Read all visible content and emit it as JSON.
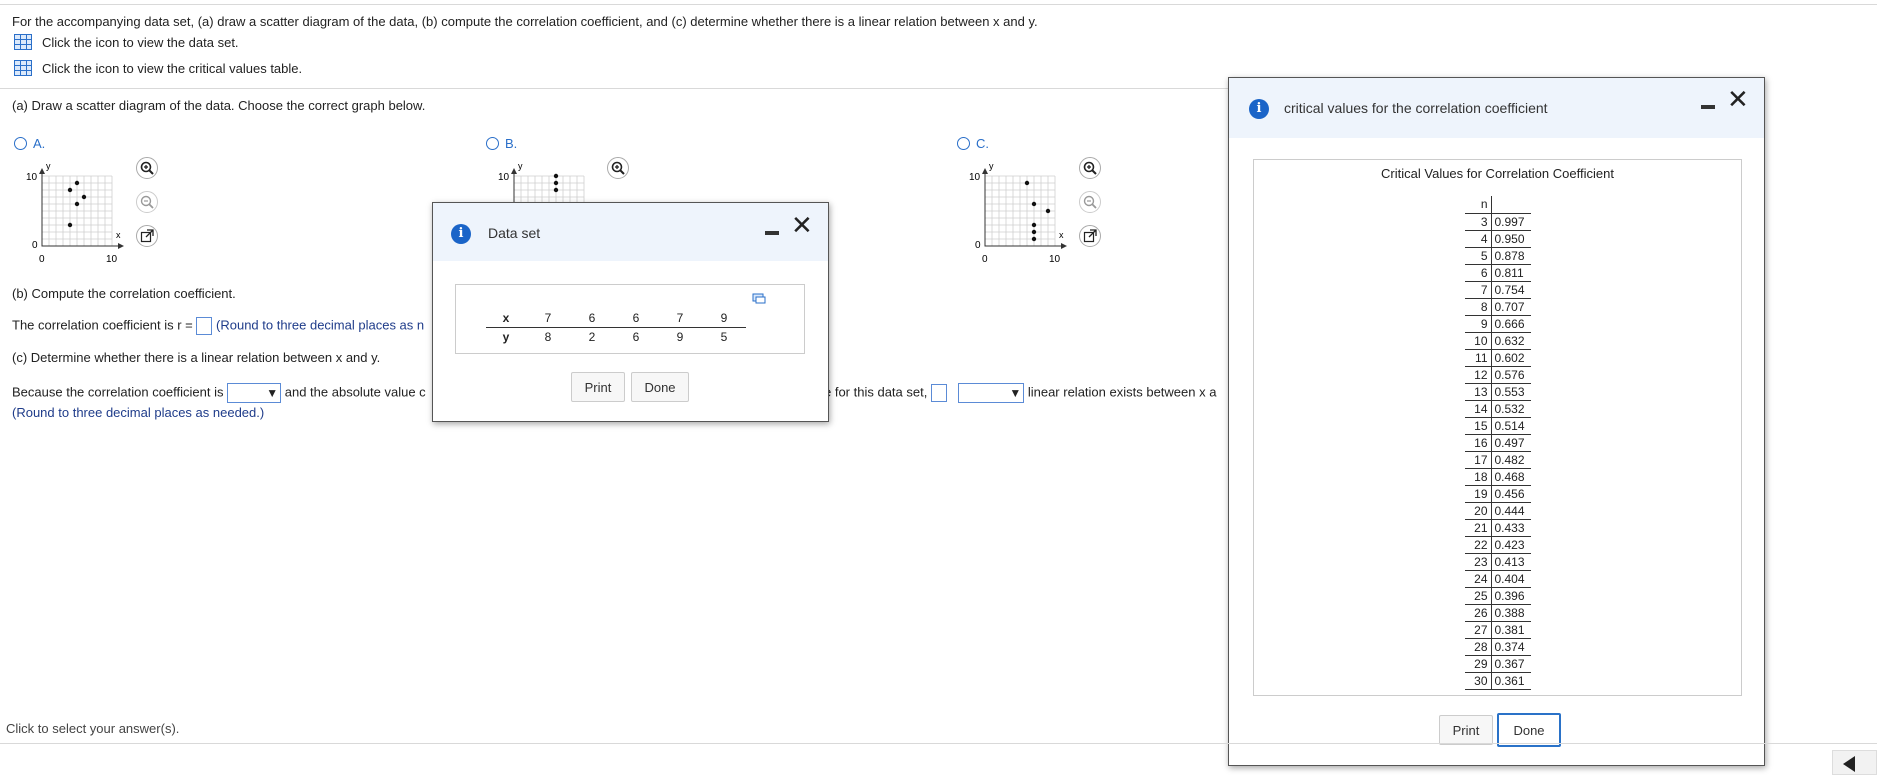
{
  "question": {
    "text": "For the accompanying data set, (a) draw a scatter diagram of the data, (b) compute the correlation coefficient, and (c) determine whether there is a linear relation between x and y.",
    "dataset_link": "Click the icon to view the data set.",
    "critical_link": "Click the icon to view the critical values table."
  },
  "part_a": {
    "prompt": "(a) Draw a scatter diagram of the data. Choose the correct graph below.",
    "options": [
      {
        "label": "A.",
        "axis_y_max": "10",
        "axis_y_min": "0",
        "axis_x_min": "0",
        "axis_x_max": "10",
        "x_label": "x",
        "y_label": "y",
        "points": [
          [
            5,
            9
          ],
          [
            4,
            8
          ],
          [
            6,
            7
          ],
          [
            5,
            6
          ],
          [
            4,
            3
          ]
        ]
      },
      {
        "label": "B.",
        "axis_y_max": "10",
        "axis_y_min": "0",
        "axis_x_min": "0",
        "axis_x_max": "10",
        "x_label": "x",
        "y_label": "y",
        "points": [
          [
            6,
            10
          ],
          [
            6,
            9
          ],
          [
            6,
            8
          ]
        ]
      },
      {
        "label": "C.",
        "axis_y_max": "10",
        "axis_y_min": "0",
        "axis_x_min": "0",
        "axis_x_max": "10",
        "x_label": "x",
        "y_label": "y",
        "points": [
          [
            6,
            9
          ],
          [
            9,
            5
          ],
          [
            7,
            6
          ],
          [
            7,
            3
          ],
          [
            7,
            2
          ],
          [
            7,
            1
          ]
        ]
      }
    ]
  },
  "part_b": {
    "prompt": "(b) Compute the correlation coefficient.",
    "line_prefix": "The correlation coefficient is r =",
    "hint": "(Round to three decimal places as n"
  },
  "part_c": {
    "prompt": "(c) Determine whether there is a linear relation between x and y.",
    "line_start": "Because the correlation coefficient is",
    "line_mid": "and the absolute value c",
    "line_after_dialog": "e for this data set,",
    "line_end": "linear relation exists between x a",
    "hint": "(Round to three decimal places as needed.)"
  },
  "dataset_dialog": {
    "title": "Data set",
    "x_label": "x",
    "y_label": "y",
    "x": [
      "7",
      "6",
      "6",
      "7",
      "9"
    ],
    "y": [
      "8",
      "2",
      "6",
      "9",
      "5"
    ],
    "print": "Print",
    "done": "Done"
  },
  "critical_dialog": {
    "title": "critical values for the correlation coefficient",
    "table_title": "Critical Values for Correlation Coefficient",
    "n_header": "n",
    "rows": [
      [
        "3",
        "0.997"
      ],
      [
        "4",
        "0.950"
      ],
      [
        "5",
        "0.878"
      ],
      [
        "6",
        "0.811"
      ],
      [
        "7",
        "0.754"
      ],
      [
        "8",
        "0.707"
      ],
      [
        "9",
        "0.666"
      ],
      [
        "10",
        "0.632"
      ],
      [
        "11",
        "0.602"
      ],
      [
        "12",
        "0.576"
      ],
      [
        "13",
        "0.553"
      ],
      [
        "14",
        "0.532"
      ],
      [
        "15",
        "0.514"
      ],
      [
        "16",
        "0.497"
      ],
      [
        "17",
        "0.482"
      ],
      [
        "18",
        "0.468"
      ],
      [
        "19",
        "0.456"
      ],
      [
        "20",
        "0.444"
      ],
      [
        "21",
        "0.433"
      ],
      [
        "22",
        "0.423"
      ],
      [
        "23",
        "0.413"
      ],
      [
        "24",
        "0.404"
      ],
      [
        "25",
        "0.396"
      ],
      [
        "26",
        "0.388"
      ],
      [
        "27",
        "0.381"
      ],
      [
        "28",
        "0.374"
      ],
      [
        "29",
        "0.367"
      ],
      [
        "30",
        "0.361"
      ]
    ],
    "print": "Print",
    "done": "Done"
  },
  "footer": {
    "text": "Click to select your answer(s)."
  },
  "colors": {
    "accent": "#2a6fc9",
    "dialog_header": "#eef4fc",
    "info_icon": "#1a64c8"
  }
}
